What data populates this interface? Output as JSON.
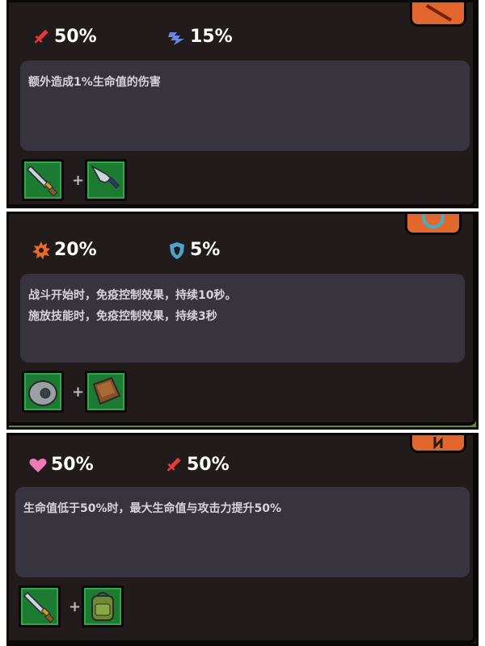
{
  "cards": [
    {
      "title": "",
      "stats": [
        {
          "icon": "red-sword-icon",
          "value": "50%"
        },
        {
          "icon": "blue-speed-icon",
          "value": "15%"
        }
      ],
      "description": [
        "额外造成1%生命值的伤害"
      ],
      "materials": [
        "steel-sword-icon",
        "kunai-icon"
      ]
    },
    {
      "title": "",
      "stats": [
        {
          "icon": "orange-gear-icon",
          "value": "20%"
        },
        {
          "icon": "blue-shield-icon",
          "value": "5%"
        }
      ],
      "description": [
        "战斗开始时，免疫控制效果，持续10秒。",
        "施放技能时，免疫控制效果，持续3秒"
      ],
      "materials": [
        "stone-wheel-icon",
        "leather-book-icon"
      ]
    },
    {
      "title": "",
      "stats": [
        {
          "icon": "pink-heart-icon",
          "value": "50%"
        },
        {
          "icon": "red-sword-icon",
          "value": "50%"
        }
      ],
      "description": [
        "生命值低于50%时，最大生命值与攻击力提升50%"
      ],
      "materials": [
        "steel-sword-icon",
        "backpack-icon"
      ]
    }
  ],
  "colors": {
    "panel": "#221b1b",
    "description_box": "#37343e",
    "slot_green": "#1c7a32",
    "title_orange": "#f08a2a",
    "badge_orange": "#e2672c"
  }
}
